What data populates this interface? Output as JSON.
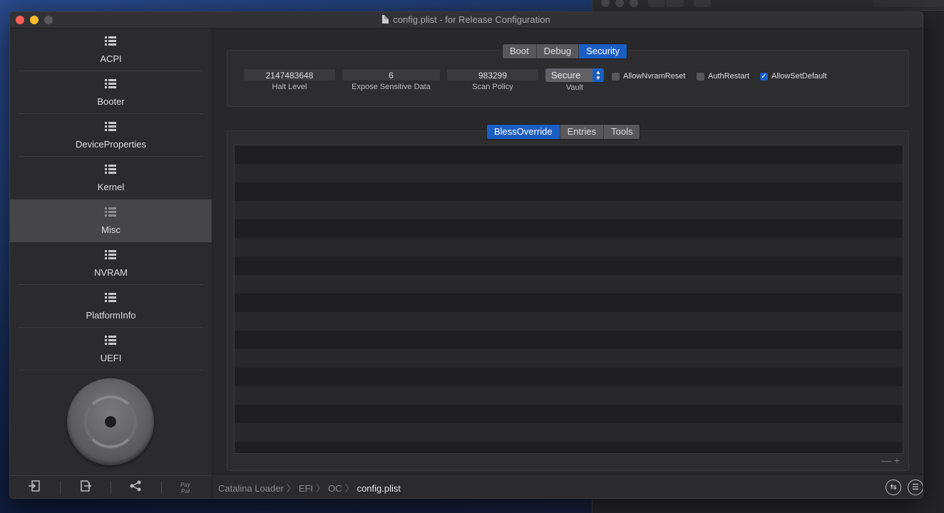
{
  "window": {
    "title": "config.plist - for Release Configuration"
  },
  "sidebar": {
    "items": [
      {
        "label": "ACPI",
        "active": false
      },
      {
        "label": "Booter",
        "active": false
      },
      {
        "label": "DeviceProperties",
        "active": false
      },
      {
        "label": "Kernel",
        "active": false
      },
      {
        "label": "Misc",
        "active": true
      },
      {
        "label": "NVRAM",
        "active": false
      },
      {
        "label": "PlatformInfo",
        "active": false
      },
      {
        "label": "UEFI",
        "active": false
      }
    ],
    "toolbar": {
      "paypal_label_1": "Pay",
      "paypal_label_2": "Pal"
    }
  },
  "misc": {
    "top_tabs": [
      {
        "label": "Boot",
        "active": false
      },
      {
        "label": "Debug",
        "active": false
      },
      {
        "label": "Security",
        "active": true
      }
    ],
    "security": {
      "halt_level": {
        "value": "2147483648",
        "label": "Halt Level"
      },
      "expose_sensitive_data": {
        "value": "6",
        "label": "Expose Sensitive Data"
      },
      "scan_policy": {
        "value": "983299",
        "label": "Scan Policy"
      },
      "vault": {
        "value": "Secure",
        "label": "Vault"
      },
      "checkboxes": [
        {
          "label": "AllowNvramReset",
          "checked": false
        },
        {
          "label": "AuthRestart",
          "checked": false
        },
        {
          "label": "AllowSetDefault",
          "checked": true
        }
      ]
    },
    "list_tabs": [
      {
        "label": "BlessOverride",
        "active": true
      },
      {
        "label": "Entries",
        "active": false
      },
      {
        "label": "Tools",
        "active": false
      }
    ]
  },
  "breadcrumb": {
    "items": [
      "Catalina Loader",
      "EFI",
      "OC"
    ],
    "current": "config.plist"
  },
  "colors": {
    "accent": "#1b5ec2",
    "close": "#ff5f57",
    "minimize": "#febc2e"
  }
}
